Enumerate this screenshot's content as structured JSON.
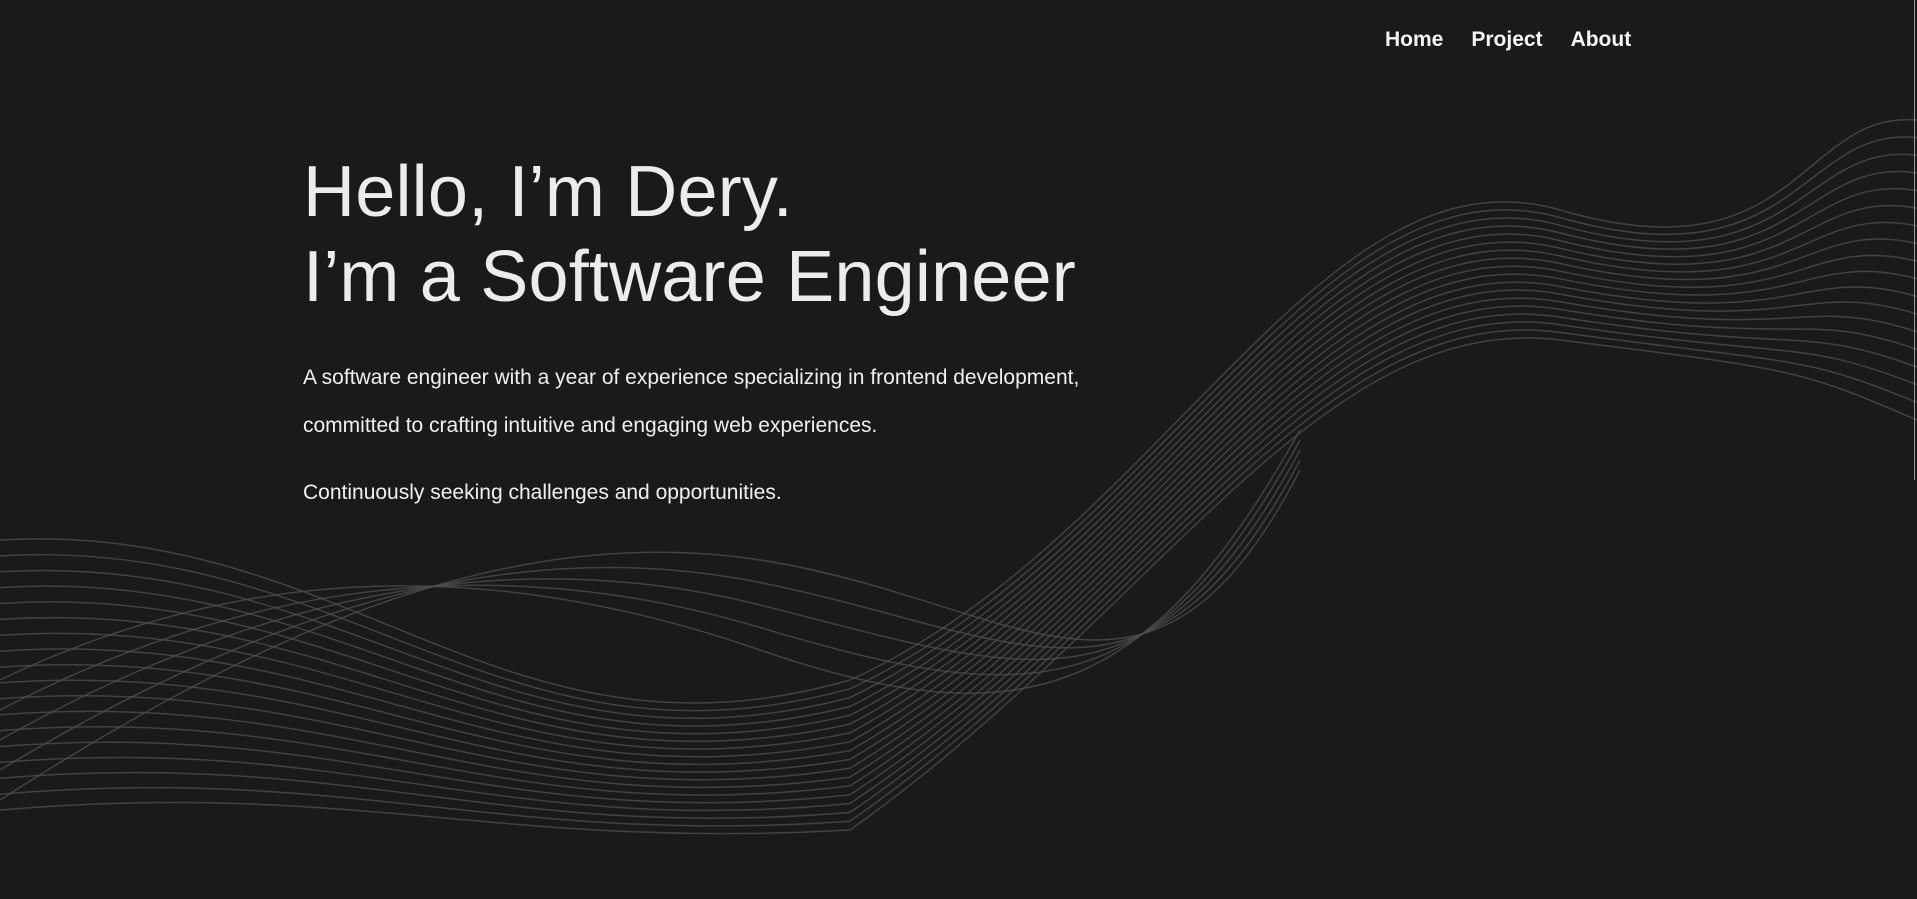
{
  "nav": {
    "items": [
      {
        "label": "Home"
      },
      {
        "label": "Project"
      },
      {
        "label": "About"
      }
    ]
  },
  "hero": {
    "heading_line1": "Hello, I’m Dery.",
    "heading_line2": "I’m a Software Engineer",
    "intro": "A software engineer with a year of experience specializing in frontend development, committed to crafting intuitive and engaging web experiences.",
    "tagline": "Continuously seeking challenges and opportunities."
  },
  "colors": {
    "background": "#1a1a1a",
    "text": "#f2f2f2",
    "wave_lines": "#505050"
  }
}
